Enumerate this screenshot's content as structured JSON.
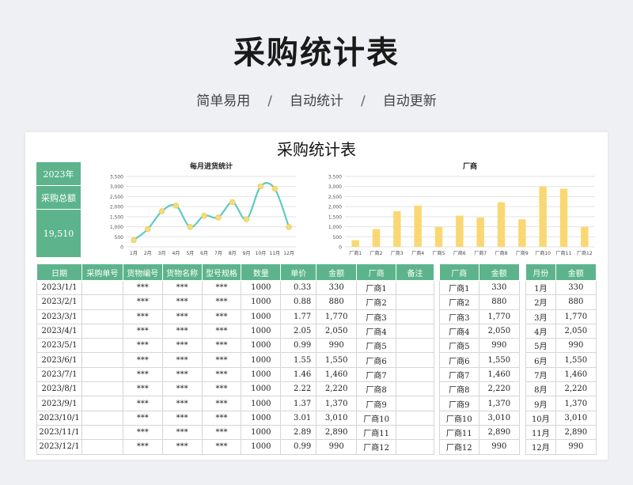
{
  "hero": {
    "title": "采购统计表",
    "subtitle_1": "简单易用",
    "subtitle_2": "自动统计",
    "subtitle_3": "自动更新",
    "separator": "/"
  },
  "sheet": {
    "title": "采购统计表",
    "year_label": "2023年",
    "total_label": "采购总额",
    "total_value": "19,510"
  },
  "colors": {
    "accent": "#5db48c",
    "line": "#5fcbc0",
    "marker": "#f5de7a",
    "bar": "#f9d874"
  },
  "chart_data": [
    {
      "type": "line",
      "title": "每月进货统计",
      "categories": [
        "1月",
        "2月",
        "3月",
        "4月",
        "5月",
        "6月",
        "7月",
        "8月",
        "9月",
        "10月",
        "11月",
        "12月"
      ],
      "values": [
        330,
        880,
        1770,
        2050,
        990,
        1550,
        1460,
        2220,
        1370,
        3010,
        2890,
        990
      ],
      "yticks": [
        "3,500",
        "3,000",
        "2,500",
        "2,000",
        "1,500",
        "1,000",
        "500",
        "0"
      ],
      "ylim": [
        0,
        3500
      ],
      "grid": true
    },
    {
      "type": "bar",
      "title": "厂商",
      "categories": [
        "厂商1",
        "厂商2",
        "厂商3",
        "厂商4",
        "厂商5",
        "厂商6",
        "厂商7",
        "厂商8",
        "厂商9",
        "厂商10",
        "厂商11",
        "厂商12"
      ],
      "values": [
        330,
        880,
        1770,
        2050,
        990,
        1550,
        1460,
        2220,
        1370,
        3010,
        2890,
        990
      ],
      "yticks": [
        "3,500",
        "3,000",
        "2,500",
        "2,000",
        "1,500",
        "1,000",
        "500",
        "0"
      ],
      "ylim": [
        0,
        3500
      ],
      "grid": true
    }
  ],
  "main_table": {
    "headers": [
      "日期",
      "采购单号",
      "货物编号",
      "货物名称",
      "型号规格",
      "数量",
      "单价",
      "金额",
      "厂商",
      "备注"
    ],
    "rows": [
      [
        "2023/1/1",
        "",
        "***",
        "***",
        "***",
        "1000",
        "0.33",
        "330",
        "厂商1",
        ""
      ],
      [
        "2023/2/1",
        "",
        "***",
        "***",
        "***",
        "1000",
        "0.88",
        "880",
        "厂商2",
        ""
      ],
      [
        "2023/3/1",
        "",
        "***",
        "***",
        "***",
        "1000",
        "1.77",
        "1,770",
        "厂商3",
        ""
      ],
      [
        "2023/4/1",
        "",
        "***",
        "***",
        "***",
        "1000",
        "2.05",
        "2,050",
        "厂商4",
        ""
      ],
      [
        "2023/5/1",
        "",
        "***",
        "***",
        "***",
        "1000",
        "0.99",
        "990",
        "厂商5",
        ""
      ],
      [
        "2023/6/1",
        "",
        "***",
        "***",
        "***",
        "1000",
        "1.55",
        "1,550",
        "厂商6",
        ""
      ],
      [
        "2023/7/1",
        "",
        "***",
        "***",
        "***",
        "1000",
        "1.46",
        "1,460",
        "厂商7",
        ""
      ],
      [
        "2023/8/1",
        "",
        "***",
        "***",
        "***",
        "1000",
        "2.22",
        "2,220",
        "厂商8",
        ""
      ],
      [
        "2023/9/1",
        "",
        "***",
        "***",
        "***",
        "1000",
        "1.37",
        "1,370",
        "厂商9",
        ""
      ],
      [
        "2023/10/1",
        "",
        "***",
        "***",
        "***",
        "1000",
        "3.01",
        "3,010",
        "厂商10",
        ""
      ],
      [
        "2023/11/1",
        "",
        "***",
        "***",
        "***",
        "1000",
        "2.89",
        "2,890",
        "厂商11",
        ""
      ],
      [
        "2023/12/1",
        "",
        "***",
        "***",
        "***",
        "1000",
        "0.99",
        "990",
        "厂商12",
        ""
      ]
    ]
  },
  "vendor_table": {
    "headers": [
      "厂商",
      "金额"
    ],
    "rows": [
      [
        "厂商1",
        "330"
      ],
      [
        "厂商2",
        "880"
      ],
      [
        "厂商3",
        "1,770"
      ],
      [
        "厂商4",
        "2,050"
      ],
      [
        "厂商5",
        "990"
      ],
      [
        "厂商6",
        "1,550"
      ],
      [
        "厂商7",
        "1,460"
      ],
      [
        "厂商8",
        "2,220"
      ],
      [
        "厂商9",
        "1,370"
      ],
      [
        "厂商10",
        "3,010"
      ],
      [
        "厂商11",
        "2,890"
      ],
      [
        "厂商12",
        "990"
      ]
    ]
  },
  "month_table": {
    "headers": [
      "月份",
      "金额"
    ],
    "rows": [
      [
        "1月",
        "330"
      ],
      [
        "2月",
        "880"
      ],
      [
        "3月",
        "1,770"
      ],
      [
        "4月",
        "2,050"
      ],
      [
        "5月",
        "990"
      ],
      [
        "6月",
        "1,550"
      ],
      [
        "7月",
        "1,460"
      ],
      [
        "8月",
        "2,220"
      ],
      [
        "9月",
        "1,370"
      ],
      [
        "10月",
        "3,010"
      ],
      [
        "11月",
        "2,890"
      ],
      [
        "12月",
        "990"
      ]
    ]
  }
}
